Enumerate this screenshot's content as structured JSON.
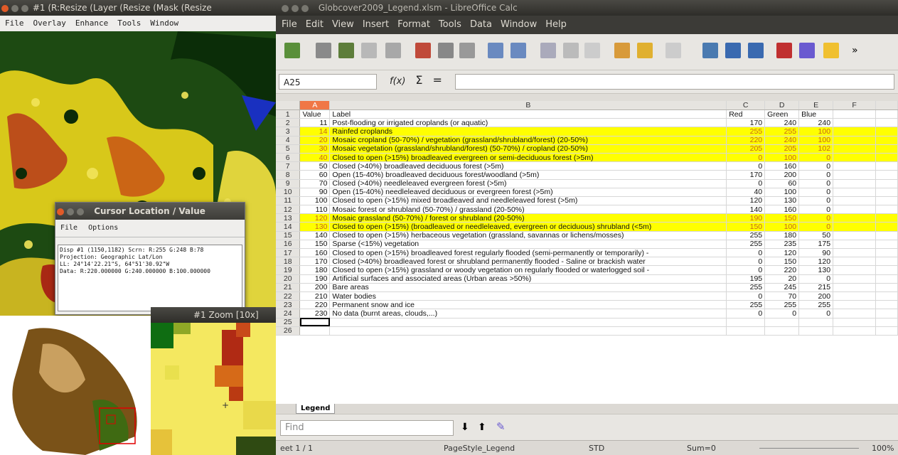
{
  "envi": {
    "title": "#1 (R:Resize (Layer (Resize (Mask (Resize",
    "menu": [
      "File",
      "Overlay",
      "Enhance",
      "Tools",
      "Window"
    ]
  },
  "cursor_window": {
    "title": "Cursor Location / Value",
    "menu": [
      "File",
      "Options"
    ],
    "lines": [
      "Disp #1 (1150,1182) Scrn: R:255 G:248 B:78",
      "Projection: Geographic Lat/Lon",
      "LL: 24°14'22.21\"S, 64°51'30.92\"W",
      "Data: R:220.000000 G:240.000000 B:100.000000"
    ]
  },
  "zoom_window": {
    "title": "#1 Zoom [10x]"
  },
  "calc": {
    "title": "Globcover2009_Legend.xlsm - LibreOffice Calc",
    "menu": [
      "File",
      "Edit",
      "View",
      "Insert",
      "Format",
      "Tools",
      "Data",
      "Window",
      "Help"
    ],
    "name_box": "A25",
    "formula_icons": [
      "f(x)",
      "Σ",
      "="
    ],
    "columns": [
      "A",
      "B",
      "C",
      "D",
      "E",
      "F"
    ],
    "header_row": [
      "Value",
      "Label",
      "Red",
      "Green",
      "Blue"
    ],
    "rows": [
      {
        "v": "11",
        "label": "Post-flooding or irrigated croplands (or aquatic)",
        "r": "170",
        "g": "240",
        "b": "240",
        "hl": false
      },
      {
        "v": "14",
        "label": "Rainfed croplands",
        "r": "255",
        "g": "255",
        "b": "100",
        "hl": true
      },
      {
        "v": "20",
        "label": "Mosaic cropland (50-70%) / vegetation (grassland/shrubland/forest) (20-50%)",
        "r": "220",
        "g": "240",
        "b": "100",
        "hl": true
      },
      {
        "v": "30",
        "label": "Mosaic vegetation (grassland/shrubland/forest) (50-70%) / cropland (20-50%)",
        "r": "205",
        "g": "205",
        "b": "102",
        "hl": true
      },
      {
        "v": "40",
        "label": "Closed to open (>15%) broadleaved evergreen or semi-deciduous forest (>5m)",
        "r": "0",
        "g": "100",
        "b": "0",
        "hl": true
      },
      {
        "v": "50",
        "label": "Closed (>40%) broadleaved deciduous forest (>5m)",
        "r": "0",
        "g": "160",
        "b": "0",
        "hl": false
      },
      {
        "v": "60",
        "label": "Open (15-40%) broadleaved deciduous forest/woodland (>5m)",
        "r": "170",
        "g": "200",
        "b": "0",
        "hl": false
      },
      {
        "v": "70",
        "label": "Closed (>40%) needleleaved evergreen forest (>5m)",
        "r": "0",
        "g": "60",
        "b": "0",
        "hl": false
      },
      {
        "v": "90",
        "label": "Open (15-40%) needleleaved deciduous or evergreen forest (>5m)",
        "r": "40",
        "g": "100",
        "b": "0",
        "hl": false
      },
      {
        "v": "100",
        "label": "Closed to open (>15%) mixed broadleaved and needleleaved forest (>5m)",
        "r": "120",
        "g": "130",
        "b": "0",
        "hl": false
      },
      {
        "v": "110",
        "label": "Mosaic forest or shrubland (50-70%) / grassland (20-50%)",
        "r": "140",
        "g": "160",
        "b": "0",
        "hl": false
      },
      {
        "v": "120",
        "label": "Mosaic grassland (50-70%) / forest or shrubland (20-50%)",
        "r": "190",
        "g": "150",
        "b": "0",
        "hl": true
      },
      {
        "v": "130",
        "label": "Closed to open (>15%) (broadleaved or needleleaved, evergreen or deciduous) shrubland (<5m)",
        "r": "150",
        "g": "100",
        "b": "0",
        "hl": true
      },
      {
        "v": "140",
        "label": "Closed to open (>15%) herbaceous vegetation (grassland, savannas or lichens/mosses)",
        "r": "255",
        "g": "180",
        "b": "50",
        "hl": false
      },
      {
        "v": "150",
        "label": "Sparse (<15%) vegetation",
        "r": "255",
        "g": "235",
        "b": "175",
        "hl": false
      },
      {
        "v": "160",
        "label": "Closed to open (>15%) broadleaved forest regularly flooded (semi-permanently or temporarily) -",
        "r": "0",
        "g": "120",
        "b": "90",
        "hl": false
      },
      {
        "v": "170",
        "label": "Closed (>40%) broadleaved forest or shrubland permanently flooded - Saline or brackish water",
        "r": "0",
        "g": "150",
        "b": "120",
        "hl": false
      },
      {
        "v": "180",
        "label": "Closed to open (>15%) grassland or woody vegetation on regularly flooded or waterlogged soil -",
        "r": "0",
        "g": "220",
        "b": "130",
        "hl": false
      },
      {
        "v": "190",
        "label": "Artificial surfaces and associated areas (Urban areas >50%)",
        "r": "195",
        "g": "20",
        "b": "0",
        "hl": false
      },
      {
        "v": "200",
        "label": "Bare areas",
        "r": "255",
        "g": "245",
        "b": "215",
        "hl": false
      },
      {
        "v": "210",
        "label": "Water bodies",
        "r": "0",
        "g": "70",
        "b": "200",
        "hl": false
      },
      {
        "v": "220",
        "label": "Permanent snow and ice",
        "r": "255",
        "g": "255",
        "b": "255",
        "hl": false
      },
      {
        "v": "230",
        "label": "No data (burnt areas, clouds,...)",
        "r": "0",
        "g": "0",
        "b": "0",
        "hl": false
      }
    ],
    "sheet_tab": "Legend",
    "find_placeholder": "Find",
    "status": {
      "sheet": "eet 1 / 1",
      "page_style": "PageStyle_Legend",
      "mode": "STD",
      "sum": "Sum=0",
      "zoom": "100%"
    }
  }
}
